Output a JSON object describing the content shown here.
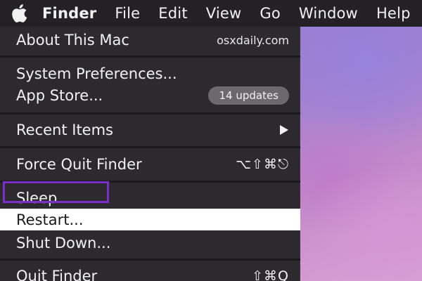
{
  "menubar": {
    "apple_icon": "apple-logo-icon",
    "items": [
      "Finder",
      "File",
      "Edit",
      "View",
      "Go",
      "Window",
      "Help"
    ]
  },
  "apple_menu": {
    "about": {
      "label": "About This Mac",
      "note": "osxdaily.com"
    },
    "system_preferences": {
      "label": "System Preferences..."
    },
    "app_store": {
      "label": "App Store...",
      "badge": "14 updates"
    },
    "recent_items": {
      "label": "Recent Items",
      "submenu_icon": "submenu-arrow-icon"
    },
    "force_quit": {
      "label": "Force Quit Finder",
      "shortcut": "⌥⇧⌘⎋"
    },
    "sleep": {
      "label": "Sleep"
    },
    "restart": {
      "label": "Restart..."
    },
    "shut_down": {
      "label": "Shut Down..."
    },
    "quit": {
      "label": "Quit Finder",
      "shortcut": "⇧⌘Q"
    }
  },
  "colors": {
    "menubar_bg": "#232125",
    "menu_bg": "#2c2a2e",
    "highlight_bg": "#ffffff",
    "focus_outline": "#7b2fc9"
  }
}
